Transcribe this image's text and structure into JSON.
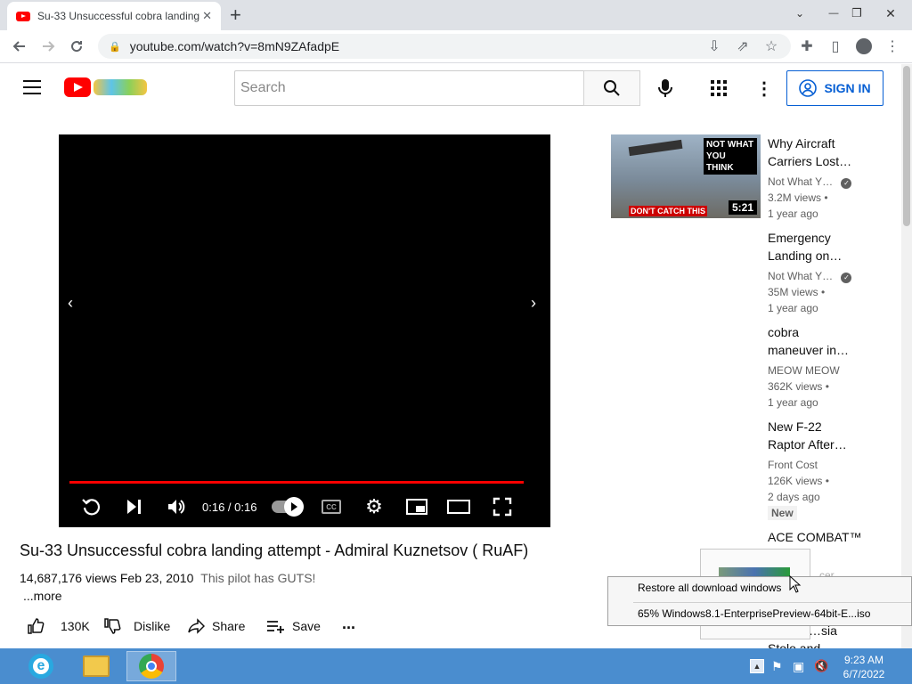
{
  "browser": {
    "tab_title": "Su-33 Unsuccessful cobra landing attempt",
    "url": "youtube.com/watch?v=8mN9ZAfadpE",
    "new_tab": "+",
    "win_min": "—",
    "win_restore": "❐",
    "win_close": "✕"
  },
  "youtube": {
    "search_placeholder": "Search",
    "sign_in": "SIGN IN"
  },
  "player": {
    "time": "0:16 / 0:16",
    "progress_fraction": 1.0
  },
  "video": {
    "title": "Su-33 Unsuccessful cobra landing attempt - Admiral Kuznetsov ( RuAF)",
    "views_date": "14,687,176 views  Feb 23, 2010",
    "description": "This pilot has GUTS!",
    "more": "...more",
    "likes": "130K",
    "dislike": "Dislike",
    "share": "Share",
    "save": "Save",
    "overflow": "..."
  },
  "recommendations": [
    {
      "title": "Why Aircraft Carriers Lost…",
      "channel": "Not What Y…",
      "views": "3.2M views •",
      "age": "1 year ago",
      "duration": "5:21",
      "thumb_text_top": "NOT WHAT YOU THINK",
      "thumb_text_bottom": "DON'T CATCH THIS"
    },
    {
      "title": "Emergency Landing on…",
      "channel": "Not What Y…",
      "views": "35M views •",
      "age": "1 year ago"
    },
    {
      "title": "cobra maneuver in…",
      "channel": "MEOW MEOW",
      "views": "362K views •",
      "age": "1 year ago"
    },
    {
      "title": "New F-22 Raptor After…",
      "channel": "Front Cost",
      "views": "126K views •",
      "age": "2 days ago",
      "badge": "New"
    },
    {
      "title": "ACE COMBAT™ …",
      "partial_1": "…cer",
      "partial_2": "…sia",
      "partial_3": "Stolo and"
    }
  ],
  "download_popup": {
    "restore": "Restore all download windows",
    "item": "65% Windows8.1-EnterprisePreview-64bit-E...iso"
  },
  "taskbar": {
    "time": "9:23 AM",
    "date": "6/7/2022"
  }
}
